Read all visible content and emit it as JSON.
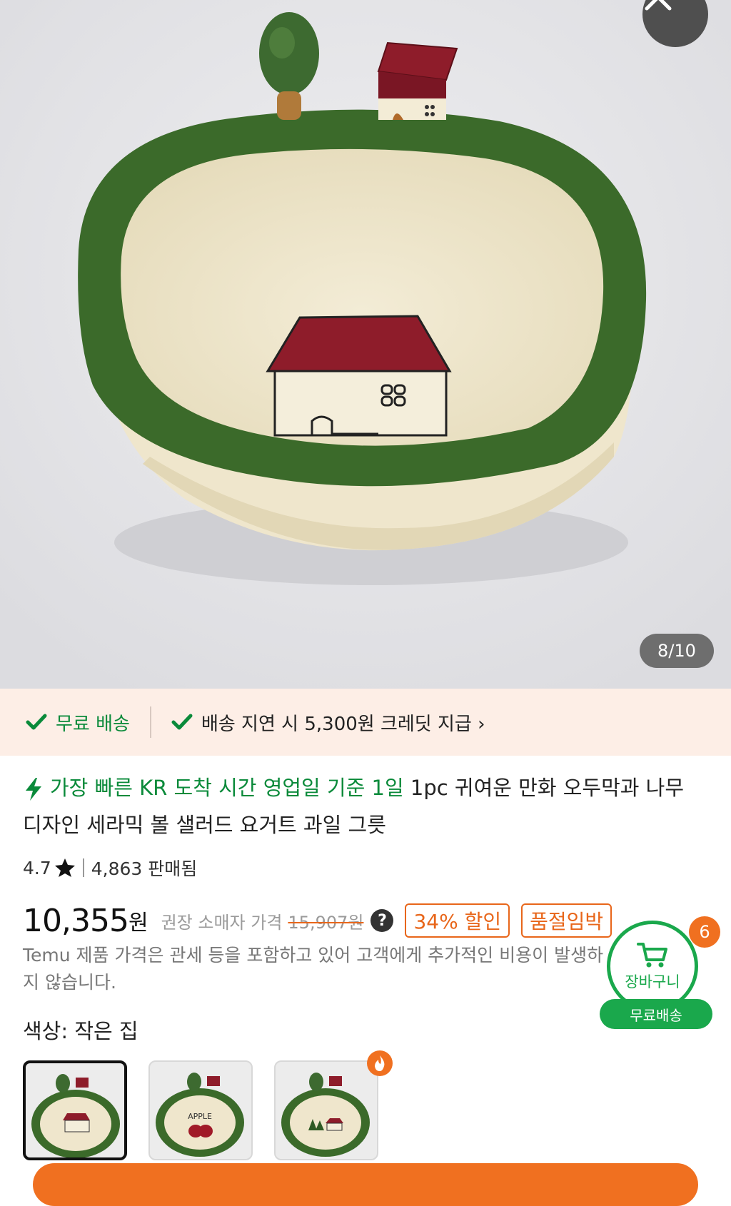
{
  "gallery": {
    "counter": "8/10",
    "close_icon": "close-icon"
  },
  "shipping": {
    "free": "무료 배송",
    "credit": "배송 지연 시 5,300원 크레딧 지급 ›"
  },
  "product": {
    "fast_tag": "가장 빠른 KR 도착 시간 영업일 기준 1일",
    "title": " 1pc 귀여운 만화 오두막과 나무 디자인 세라믹 볼 샐러드 요거트 과일 그릇",
    "rating": "4.7",
    "sold": "4,863 판매됨",
    "price": "10,355",
    "price_unit": "원",
    "retail_label": "권장 소매자 가격",
    "retail_price": "15,907원",
    "discount": "34% 할인",
    "stock_badge": "품절임박",
    "tax_note": "Temu 제품 가격은 관세 등을 포함하고 있어 고객에게 추가적인 비용이 발생하지 않습니다."
  },
  "cart": {
    "label": "장바구니",
    "count": "6",
    "free_shipping": "무료배송"
  },
  "options": {
    "color_label": "색상: 작은 집",
    "swatches": [
      "작은 집",
      "Apple",
      "나무와 집"
    ],
    "apple_text": "APPLE"
  },
  "colors": {
    "green": "#0a8a3a",
    "orange": "#e8661a",
    "bowl_green": "#3b6a2a",
    "roof_red": "#8e1c2a"
  }
}
